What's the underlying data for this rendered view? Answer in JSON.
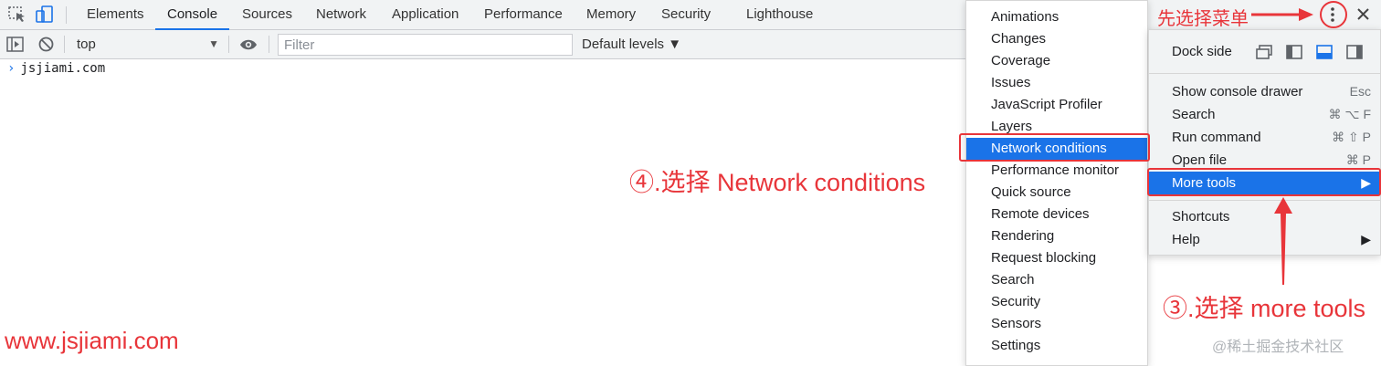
{
  "tabs": [
    {
      "label": "Elements",
      "active": false
    },
    {
      "label": "Console",
      "active": true
    },
    {
      "label": "Sources",
      "active": false
    },
    {
      "label": "Network",
      "active": false
    },
    {
      "label": "Application",
      "active": false
    },
    {
      "label": "Performance",
      "active": false
    },
    {
      "label": "Memory",
      "active": false
    },
    {
      "label": "Security",
      "active": false
    },
    {
      "label": "Lighthouse",
      "active": false
    }
  ],
  "toolbar": {
    "context": "top",
    "filter_placeholder": "Filter",
    "levels": "Default levels ▼"
  },
  "console": {
    "prompt": "›",
    "line": "jsjiami.com"
  },
  "more_tools_menu": [
    "Animations",
    "Changes",
    "Coverage",
    "Issues",
    "JavaScript Profiler",
    "Layers",
    "Network conditions",
    "Performance monitor",
    "Quick source",
    "Remote devices",
    "Rendering",
    "Request blocking",
    "Search",
    "Security",
    "Sensors",
    "Settings"
  ],
  "main_menu": {
    "dock_side": "Dock side",
    "items": [
      {
        "label": "Show console drawer",
        "shortcut": "Esc"
      },
      {
        "label": "Search",
        "shortcut": "⌘ ⌥ F"
      },
      {
        "label": "Run command",
        "shortcut": "⌘ ⇧ P"
      },
      {
        "label": "Open file",
        "shortcut": "⌘ P"
      },
      {
        "label": "More tools",
        "shortcut": "▶"
      },
      {
        "label": "Shortcuts",
        "shortcut": ""
      },
      {
        "label": "Help",
        "shortcut": "▶"
      }
    ]
  },
  "annotations": {
    "step1": "先选择菜单",
    "step3": "③.选择 more tools",
    "step4": "④.选择 Network conditions",
    "watermark": "www.jsjiami.com",
    "credit": "@稀土掘金技术社区"
  },
  "colors": {
    "accent": "#1a73e8",
    "annotation": "#e8353a"
  },
  "icons": {
    "inspect": "inspect-element-icon",
    "device": "device-toolbar-icon",
    "sidebar": "show-sidebar-icon",
    "clear": "clear-console-icon",
    "eye": "live-expression-icon",
    "kebab": "kebab-menu-icon",
    "close": "close-icon"
  }
}
